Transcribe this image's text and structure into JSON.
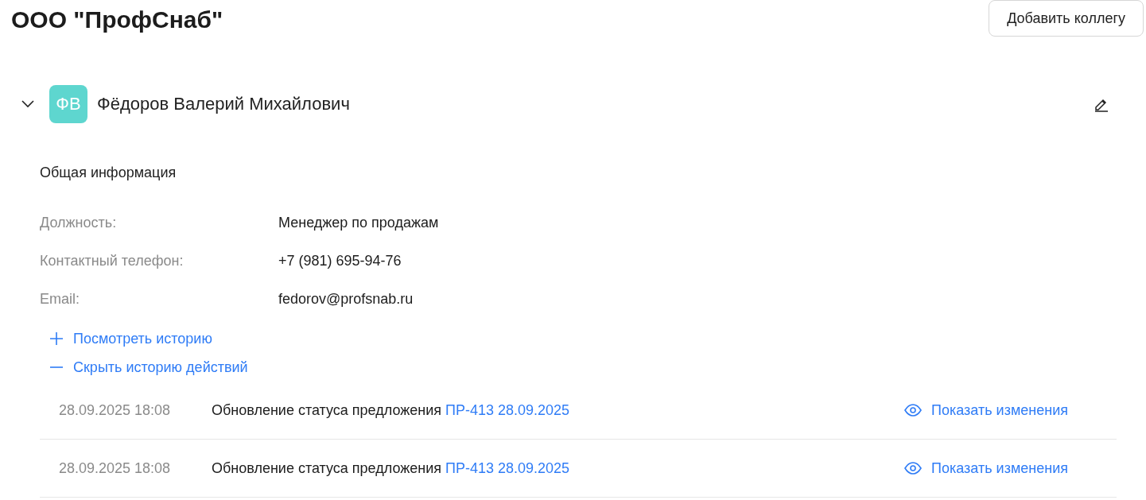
{
  "title": "ООО \"ПрофСнаб\"",
  "add_button": "Добавить коллегу",
  "employee": {
    "expanded": true,
    "initials": "ФВ",
    "name": "Фёдоров Валерий Михайлович",
    "section_title": "Общая информация",
    "fields": [
      {
        "label": "Должность:",
        "value": "Менеджер по продажам"
      },
      {
        "label": "Контактный телефон:",
        "value": "+7 (981) 695-94-76"
      },
      {
        "label": "Email:",
        "value": "fedorov@profsnab.ru"
      }
    ],
    "actions": [
      {
        "kind": "expand",
        "label": "Посмотреть историю"
      },
      {
        "kind": "collapse",
        "label": "Скрыть историю действий"
      }
    ],
    "history": [
      {
        "time": "28.09.2025 18:08",
        "text": "Обновление статуса предложения",
        "link": "ПР-413 28.09.2025",
        "action": "Показать изменения"
      },
      {
        "time": "28.09.2025 18:08",
        "text": "Обновление статуса предложения",
        "link": "ПР-413 28.09.2025",
        "action": "Показать изменения"
      }
    ]
  }
}
